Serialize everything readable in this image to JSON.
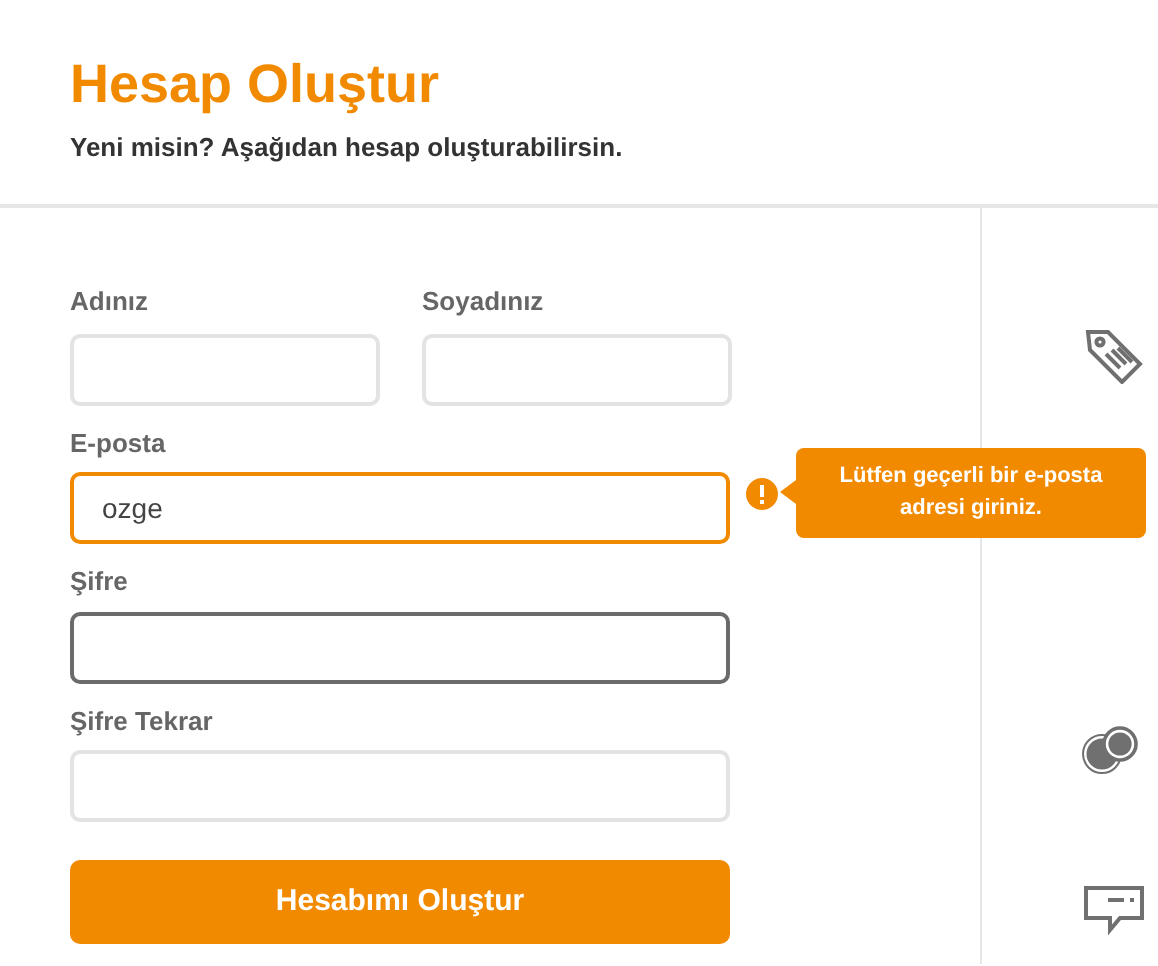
{
  "header": {
    "title": "Hesap Oluştur",
    "subtitle": "Yeni misin? Aşağıdan hesap oluşturabilirsin."
  },
  "name_fields": [
    {
      "label": "Adınız",
      "error": false,
      "focused": false
    },
    {
      "label": "Soyadınız",
      "error": false,
      "focused": false
    }
  ],
  "fields": [
    {
      "label": "E-posta",
      "value": "ozge",
      "error": true,
      "focused": false,
      "error_message": "Lütfen geçerli bir e-posta adresi giriniz."
    },
    {
      "label": "Şifre",
      "error": false,
      "focused": true
    },
    {
      "label": "Şifre Tekrar",
      "error": false,
      "focused": false
    }
  ],
  "submit_button": "Hesabımı Oluştur"
}
